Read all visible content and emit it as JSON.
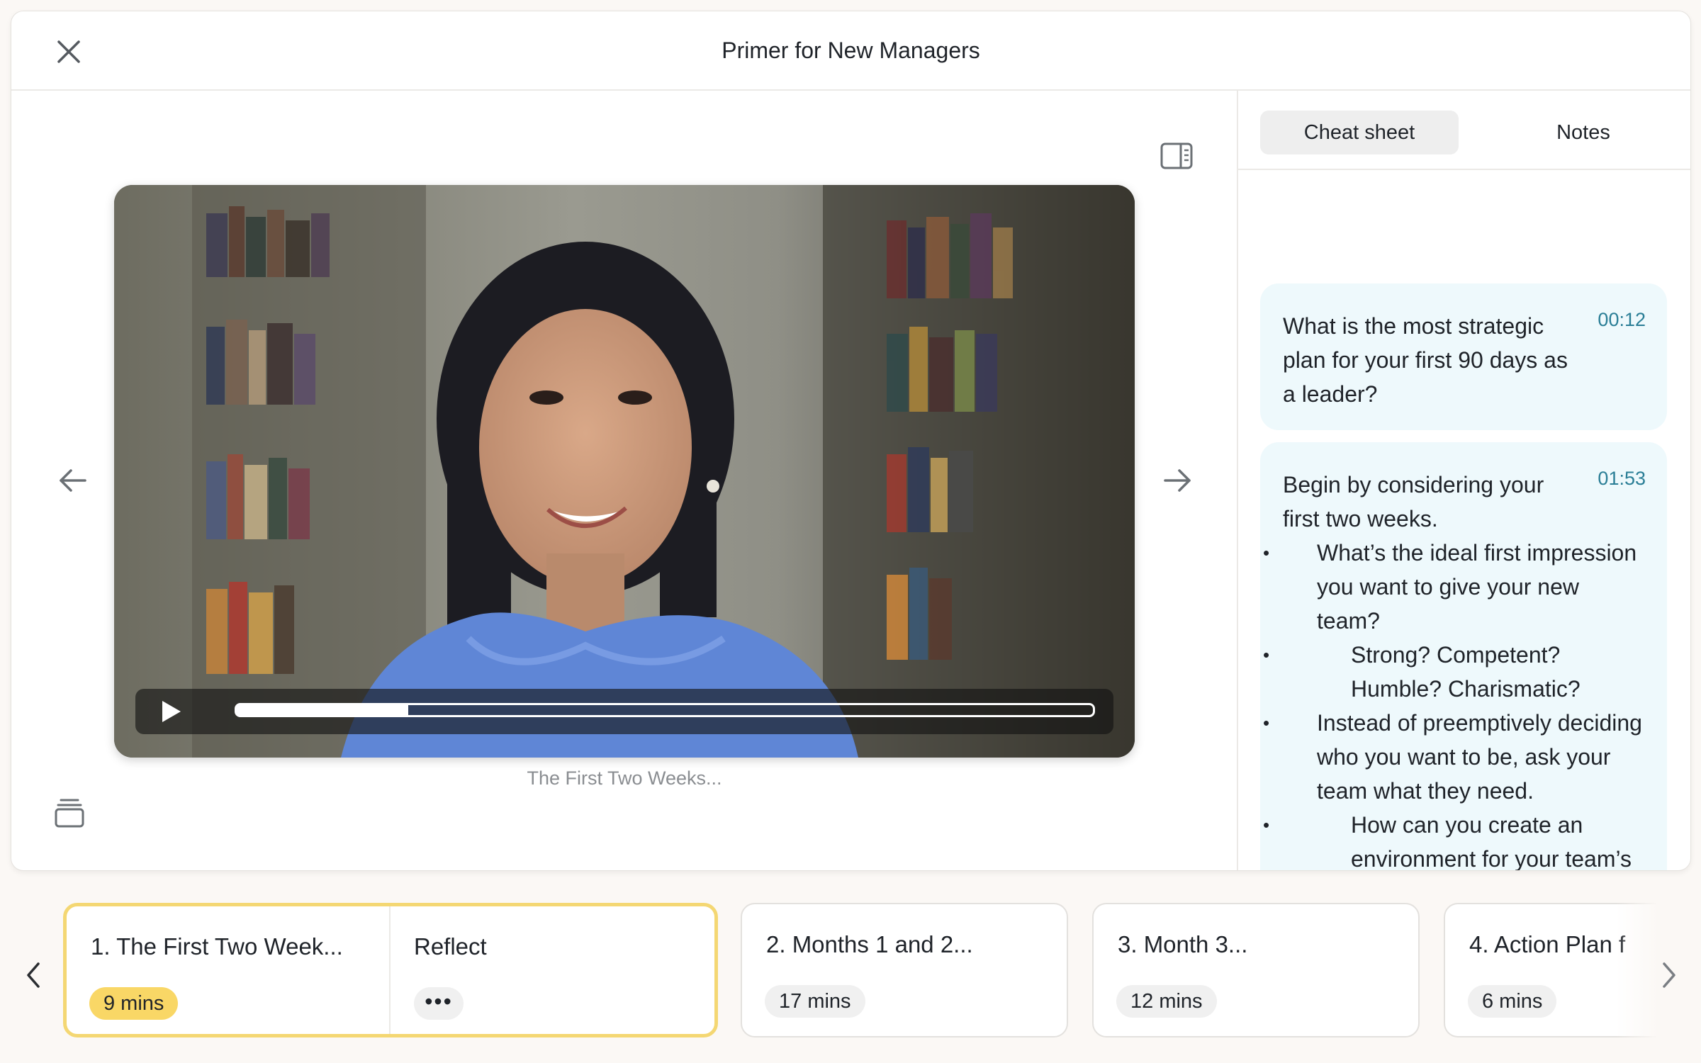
{
  "header": {
    "title": "Primer for New Managers"
  },
  "player": {
    "caption": "The First Two Weeks...",
    "progress": 0.2
  },
  "tabs": {
    "cheat_sheet": "Cheat sheet",
    "notes": "Notes"
  },
  "cheat_sheet": {
    "cards": [
      {
        "time": "00:12",
        "text": "What is the most strategic plan for your first 90 days as a leader?"
      },
      {
        "time": "01:53",
        "text": "Begin by considering your first two weeks.",
        "bullets": [
          {
            "level": 1,
            "text": "What’s the ideal first impression you want to give your new team?"
          },
          {
            "level": 2,
            "text": "Strong? Competent? Humble? Charismatic?"
          },
          {
            "level": 1,
            "text": "Instead of preemptively deciding who you want to be, ask your team what they need."
          },
          {
            "level": 2,
            "text": "How can you create an environment for your team’s success?"
          }
        ]
      }
    ]
  },
  "chapters": [
    {
      "title": "1. The First Two Week...",
      "duration": "9 mins",
      "extra_title": "Reflect",
      "more": "•••"
    },
    {
      "title": "2. Months 1 and 2...",
      "duration": "17 mins"
    },
    {
      "title": "3. Month 3...",
      "duration": "12 mins"
    },
    {
      "title": "4. Action Plan f",
      "duration": "6 mins"
    }
  ],
  "colors": {
    "accent_yellow": "#f9d766",
    "active_border": "#f4d773",
    "note_card_bg": "#eef9fc",
    "timecode": "#2a7e96"
  },
  "icons": {
    "close": "close-icon",
    "sidebar_toggle": "sidebar-panel-icon",
    "prev": "arrow-left-icon",
    "next": "arrow-right-icon",
    "stack": "stack-icon",
    "play": "play-icon"
  }
}
